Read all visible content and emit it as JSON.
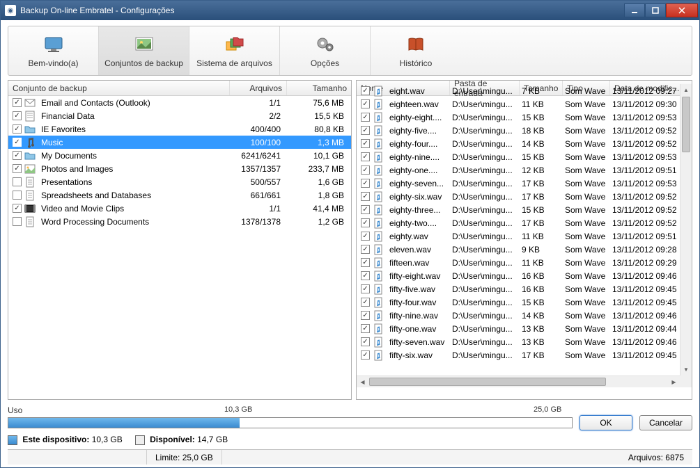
{
  "title": "Backup On-line Embratel - Configurações",
  "toolbar": {
    "tabs": [
      {
        "label": "Bem-vindo(a)",
        "icon": "monitor-icon"
      },
      {
        "label": "Conjuntos de backup",
        "icon": "picture-icon"
      },
      {
        "label": "Sistema de arquivos",
        "icon": "folders-icon"
      },
      {
        "label": "Opções",
        "icon": "gears-icon"
      },
      {
        "label": "Histórico",
        "icon": "book-icon"
      }
    ],
    "active_index": 1
  },
  "left": {
    "headers": {
      "name": "Conjunto de backup",
      "files": "Arquivos",
      "size": "Tamanho"
    },
    "rows": [
      {
        "checked": true,
        "icon": "mail",
        "name": "Email and Contacts (Outlook)",
        "files": "1/1",
        "size": "75,6 MB"
      },
      {
        "checked": true,
        "icon": "sheet",
        "name": "Financial Data",
        "files": "2/2",
        "size": "15,5 KB"
      },
      {
        "checked": true,
        "icon": "folder",
        "name": "IE Favorites",
        "files": "400/400",
        "size": "80,8 KB"
      },
      {
        "checked": true,
        "icon": "music",
        "name": "Music",
        "files": "100/100",
        "size": "1,3 MB",
        "selected": true
      },
      {
        "checked": true,
        "icon": "folder",
        "name": "My Documents",
        "files": "6241/6241",
        "size": "10,1 GB"
      },
      {
        "checked": true,
        "icon": "image",
        "name": "Photos and Images",
        "files": "1357/1357",
        "size": "233,7 MB"
      },
      {
        "checked": false,
        "icon": "doc",
        "name": "Presentations",
        "files": "500/557",
        "size": "1,6 GB"
      },
      {
        "checked": false,
        "icon": "doc",
        "name": "Spreadsheets and Databases",
        "files": "661/661",
        "size": "1,8 GB"
      },
      {
        "checked": true,
        "icon": "video",
        "name": "Video and Movie Clips",
        "files": "1/1",
        "size": "41,4 MB"
      },
      {
        "checked": false,
        "icon": "doc",
        "name": "Word Processing Documents",
        "files": "1378/1378",
        "size": "1,2 GB"
      }
    ]
  },
  "right": {
    "headers": {
      "name": "Nome",
      "path": "Pasta de entrada",
      "size": "Tamanho",
      "type": "Tipo",
      "date": "Data de modific..."
    },
    "rows": [
      {
        "name": "eight.wav",
        "path": "D:\\User\\mingu...",
        "size": "7 KB",
        "type": "Som Wave",
        "date": "13/11/2012 09:27"
      },
      {
        "name": "eighteen.wav",
        "path": "D:\\User\\mingu...",
        "size": "11 KB",
        "type": "Som Wave",
        "date": "13/11/2012 09:30"
      },
      {
        "name": "eighty-eight....",
        "path": "D:\\User\\mingu...",
        "size": "15 KB",
        "type": "Som Wave",
        "date": "13/11/2012 09:53"
      },
      {
        "name": "eighty-five....",
        "path": "D:\\User\\mingu...",
        "size": "18 KB",
        "type": "Som Wave",
        "date": "13/11/2012 09:52"
      },
      {
        "name": "eighty-four....",
        "path": "D:\\User\\mingu...",
        "size": "14 KB",
        "type": "Som Wave",
        "date": "13/11/2012 09:52"
      },
      {
        "name": "eighty-nine....",
        "path": "D:\\User\\mingu...",
        "size": "15 KB",
        "type": "Som Wave",
        "date": "13/11/2012 09:53"
      },
      {
        "name": "eighty-one....",
        "path": "D:\\User\\mingu...",
        "size": "12 KB",
        "type": "Som Wave",
        "date": "13/11/2012 09:51"
      },
      {
        "name": "eighty-seven...",
        "path": "D:\\User\\mingu...",
        "size": "17 KB",
        "type": "Som Wave",
        "date": "13/11/2012 09:53"
      },
      {
        "name": "eighty-six.wav",
        "path": "D:\\User\\mingu...",
        "size": "17 KB",
        "type": "Som Wave",
        "date": "13/11/2012 09:52"
      },
      {
        "name": "eighty-three...",
        "path": "D:\\User\\mingu...",
        "size": "15 KB",
        "type": "Som Wave",
        "date": "13/11/2012 09:52"
      },
      {
        "name": "eighty-two....",
        "path": "D:\\User\\mingu...",
        "size": "17 KB",
        "type": "Som Wave",
        "date": "13/11/2012 09:52"
      },
      {
        "name": "eighty.wav",
        "path": "D:\\User\\mingu...",
        "size": "11 KB",
        "type": "Som Wave",
        "date": "13/11/2012 09:51"
      },
      {
        "name": "eleven.wav",
        "path": "D:\\User\\mingu...",
        "size": "9 KB",
        "type": "Som Wave",
        "date": "13/11/2012 09:28"
      },
      {
        "name": "fifteen.wav",
        "path": "D:\\User\\mingu...",
        "size": "11 KB",
        "type": "Som Wave",
        "date": "13/11/2012 09:29"
      },
      {
        "name": "fifty-eight.wav",
        "path": "D:\\User\\mingu...",
        "size": "16 KB",
        "type": "Som Wave",
        "date": "13/11/2012 09:46"
      },
      {
        "name": "fifty-five.wav",
        "path": "D:\\User\\mingu...",
        "size": "16 KB",
        "type": "Som Wave",
        "date": "13/11/2012 09:45"
      },
      {
        "name": "fifty-four.wav",
        "path": "D:\\User\\mingu...",
        "size": "15 KB",
        "type": "Som Wave",
        "date": "13/11/2012 09:45"
      },
      {
        "name": "fifty-nine.wav",
        "path": "D:\\User\\mingu...",
        "size": "14 KB",
        "type": "Som Wave",
        "date": "13/11/2012 09:46"
      },
      {
        "name": "fifty-one.wav",
        "path": "D:\\User\\mingu...",
        "size": "13 KB",
        "type": "Som Wave",
        "date": "13/11/2012 09:44"
      },
      {
        "name": "fifty-seven.wav",
        "path": "D:\\User\\mingu...",
        "size": "13 KB",
        "type": "Som Wave",
        "date": "13/11/2012 09:46"
      },
      {
        "name": "fifty-six.wav",
        "path": "D:\\User\\mingu...",
        "size": "17 KB",
        "type": "Som Wave",
        "date": "13/11/2012 09:45"
      }
    ]
  },
  "usage": {
    "label": "Uso",
    "used_value": "10,3 GB",
    "total_value": "25,0 GB",
    "percent": 41,
    "legend_device": "Este dispositivo:",
    "legend_device_val": "10,3 GB",
    "legend_avail": "Disponível:",
    "legend_avail_val": "14,7 GB"
  },
  "buttons": {
    "ok": "OK",
    "cancel": "Cancelar"
  },
  "status": {
    "limit_label": "Limite:",
    "limit_value": "25,0 GB",
    "files_label": "Arquivos:",
    "files_value": "6875"
  },
  "colors": {
    "accent": "#3399ff"
  }
}
